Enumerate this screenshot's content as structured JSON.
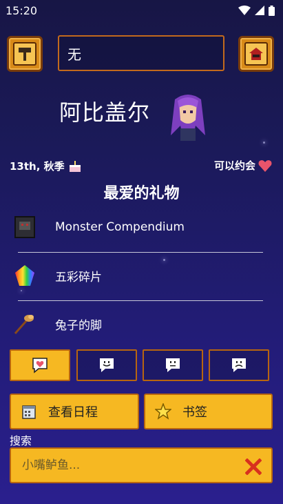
{
  "status_bar": {
    "time": "15:20"
  },
  "header": {
    "name_value": "无"
  },
  "villager": {
    "name": "阿比盖尔"
  },
  "info": {
    "birthday": "13th, 秋季",
    "dateable": "可以约会"
  },
  "gifts": {
    "title": "最爱的礼物",
    "items": [
      {
        "label": "Monster Compendium",
        "icon": "book-icon"
      },
      {
        "label": "五彩碎片",
        "icon": "prismatic-shard-icon"
      },
      {
        "label": "兔子的脚",
        "icon": "rabbit-foot-icon"
      }
    ]
  },
  "tabs": [
    {
      "name": "love",
      "icon": "heart-icon",
      "active": true
    },
    {
      "name": "like",
      "icon": "smile-bubble-icon",
      "active": false
    },
    {
      "name": "neutral",
      "icon": "neutral-bubble-icon",
      "active": false
    },
    {
      "name": "dislike",
      "icon": "frown-bubble-icon",
      "active": false
    }
  ],
  "actions": {
    "schedule": "查看日程",
    "bookmark": "书签"
  },
  "search": {
    "label": "搜索",
    "placeholder": "小嘴鲈鱼..."
  },
  "colors": {
    "accent": "#f6b822",
    "border": "#b8650f",
    "background": "#1b1a5a"
  }
}
